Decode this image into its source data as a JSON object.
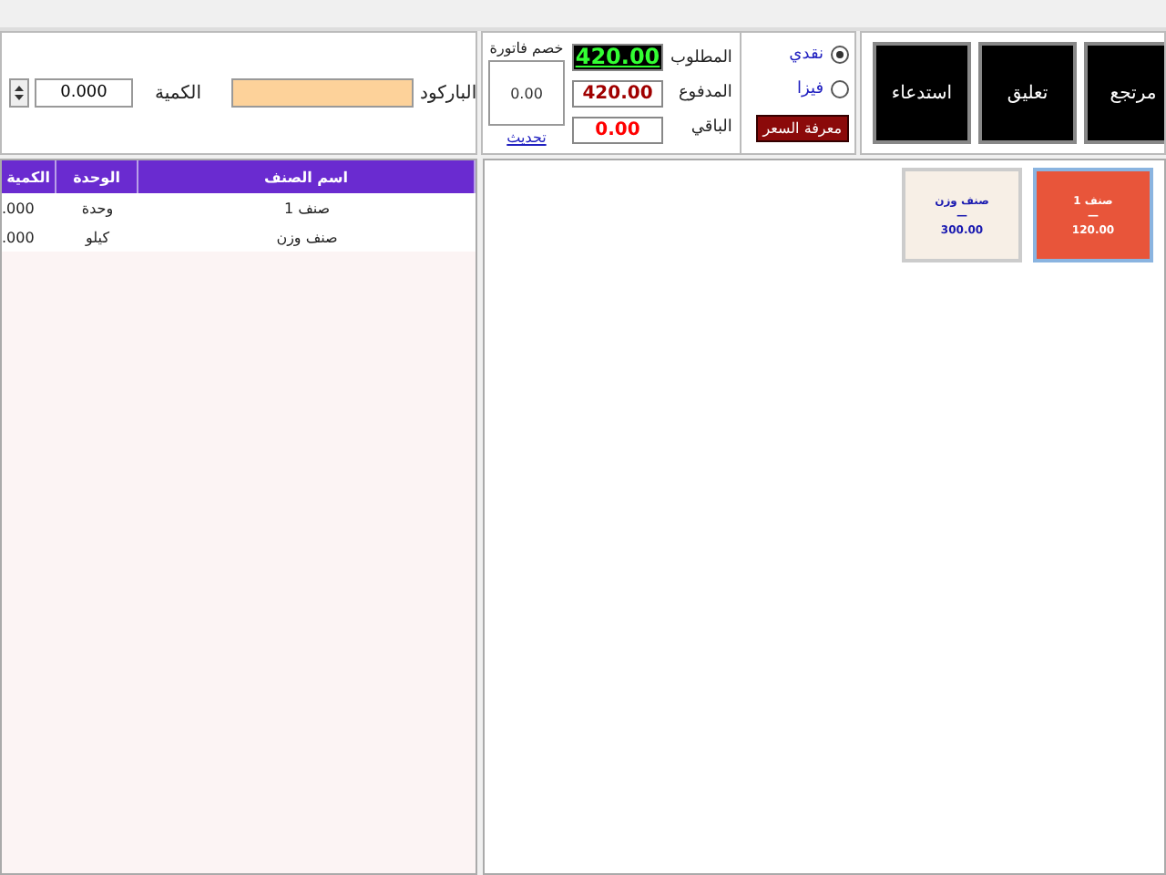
{
  "entry": {
    "barcode_label": "الباركود",
    "quantity_label": "الكمية",
    "quantity_value": "0.000"
  },
  "totals": {
    "discount_label": "خصم فاتورة",
    "discount_value": "0.00",
    "refresh_link": "تحديث",
    "rows": [
      {
        "kind": "required",
        "label": "المطلوب",
        "value": "420.00"
      },
      {
        "kind": "paid",
        "label": "المدفوع",
        "value": "420.00"
      },
      {
        "kind": "remaining",
        "label": "الباقي",
        "value": "0.00"
      }
    ]
  },
  "payment": {
    "options": [
      {
        "label": "نقدي",
        "selected": true
      },
      {
        "label": "فيزا",
        "selected": false
      }
    ],
    "price_button": "معرفة السعر"
  },
  "actions": [
    "مرتجع",
    "تعليق",
    "استدعاء"
  ],
  "table": {
    "columns": [
      "اسم الصنف",
      "الوحدة",
      "الكمية"
    ],
    "rows": [
      {
        "quantity": ".000",
        "unit": "وحدة",
        "name": "صنف 1"
      },
      {
        "quantity": ".000",
        "unit": "كيلو",
        "name": "صنف وزن"
      }
    ]
  },
  "products": [
    {
      "name": "صنف 1",
      "separator": "—",
      "price": "120.00",
      "selected": true
    },
    {
      "name": "صنف وزن",
      "separator": "—",
      "price": "300.00",
      "selected": false
    }
  ]
}
